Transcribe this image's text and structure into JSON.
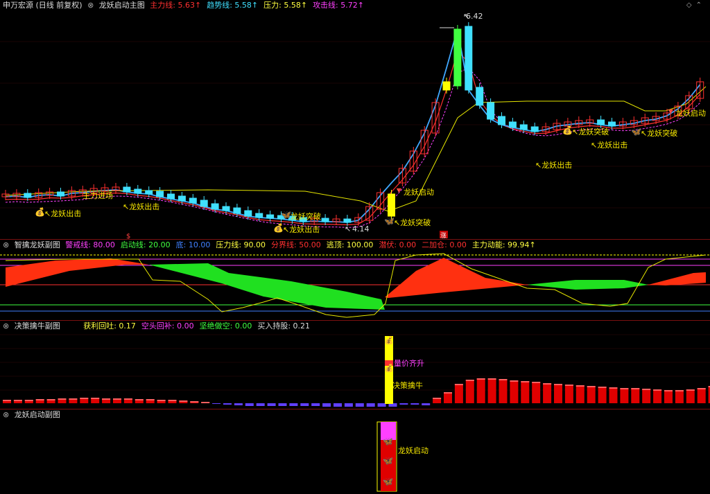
{
  "main": {
    "stock": "申万宏源 (日线 前复权)",
    "indicator": "龙妖启动主图",
    "items": [
      {
        "label": "主力线:",
        "value": "5.63",
        "color": "#ff3030"
      },
      {
        "label": "趋势线:",
        "value": "5.58",
        "color": "#40e0ff"
      },
      {
        "label": "压力:",
        "value": "5.58",
        "color": "#ffff40"
      },
      {
        "label": "攻击线:",
        "value": "5.72",
        "color": "#ff40ff"
      }
    ],
    "high_label": "6.42",
    "low_label": "4.14",
    "markers": {
      "chuji": "龙妖出击",
      "tupo": "龙妖突破",
      "qidong": "龙妖启动",
      "zhuli": "主力进场"
    }
  },
  "sub1": {
    "title": "智擒龙妖副图",
    "items": [
      {
        "label": "警戒线:",
        "value": "80.00",
        "color": "#ff40ff"
      },
      {
        "label": "启动线:",
        "value": "20.00",
        "color": "#40ff40"
      },
      {
        "label": "底:",
        "value": "10.00",
        "color": "#4080ff"
      },
      {
        "label": "压力线:",
        "value": "90.00",
        "color": "#ffff40"
      },
      {
        "label": "分界线:",
        "value": "50.00",
        "color": "#ff3030"
      },
      {
        "label": "逃顶:",
        "value": "100.00",
        "color": "#ffff40"
      },
      {
        "label": "潜伏:",
        "value": "0.00",
        "color": "#ff3030"
      },
      {
        "label": "二加仓:",
        "value": "0.00",
        "color": "#ff3030"
      },
      {
        "label": "主力动能:",
        "value": "99.94",
        "color": "#ffff40"
      }
    ]
  },
  "sub2": {
    "title": "决策擒牛副图",
    "items": [
      {
        "label": "获利回吐:",
        "value": "0.17",
        "color": "#ffff40"
      },
      {
        "label": "空头回补:",
        "value": "0.00",
        "color": "#ff40ff"
      },
      {
        "label": "坚绝做空:",
        "value": "0.00",
        "color": "#40ff40"
      },
      {
        "label": "买入持股:",
        "value": "0.21",
        "color": "#dddddd"
      }
    ],
    "label_a": "量价齐升",
    "label_b": "决策擒牛"
  },
  "sub3": {
    "title": "龙妖启动副图",
    "label": "龙妖启动"
  }
}
